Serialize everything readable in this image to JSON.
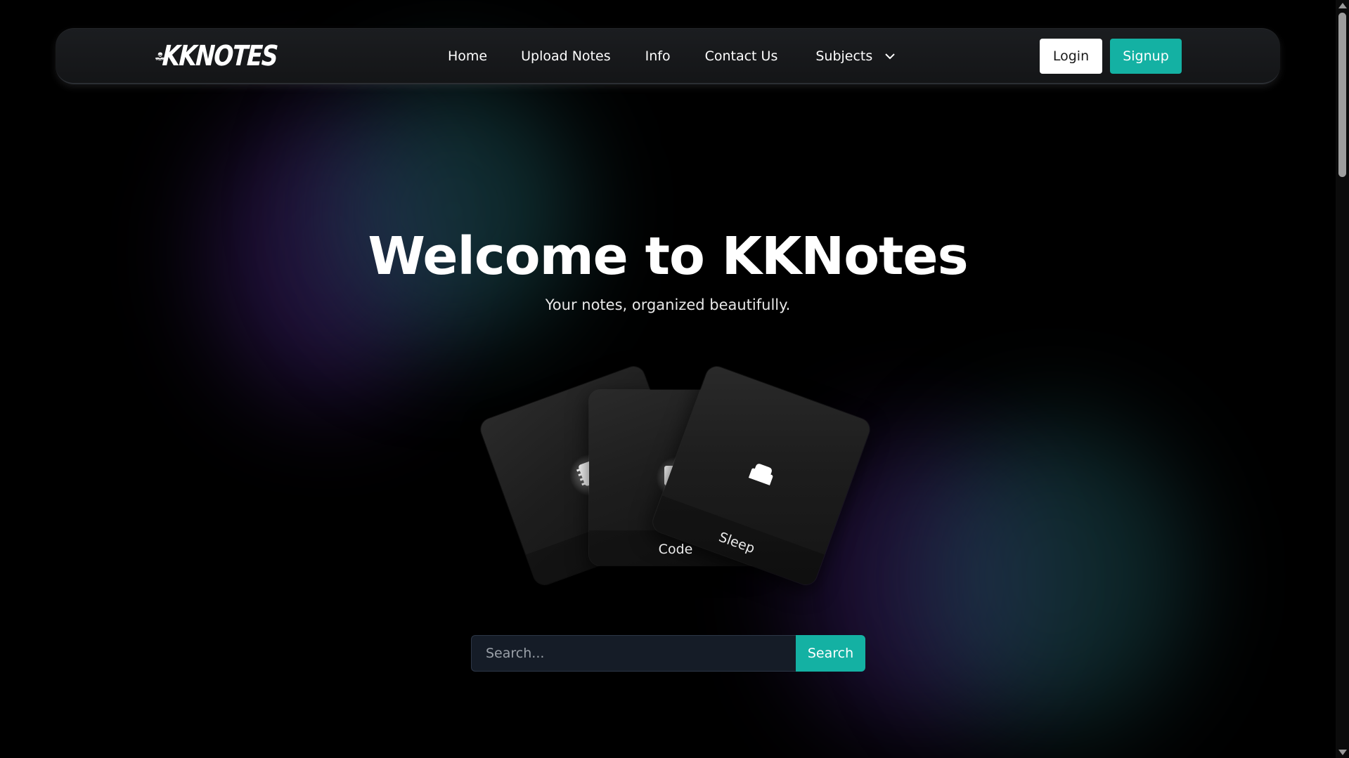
{
  "brand": {
    "logo_text": "KKNOTES"
  },
  "nav": {
    "home": "Home",
    "upload_notes": "Upload Notes",
    "info": "Info",
    "contact_us": "Contact Us",
    "subjects": "Subjects"
  },
  "auth": {
    "login_label": "Login",
    "signup_label": "Signup"
  },
  "hero": {
    "title": "Welcome to KKNotes",
    "subtitle": "Your notes, organized beautifully."
  },
  "cards": [
    {
      "label": "",
      "icon": "notebook-icon"
    },
    {
      "label": "Code",
      "icon": "code-icon"
    },
    {
      "label": "Sleep",
      "icon": "bed-icon"
    }
  ],
  "search": {
    "placeholder": "Search...",
    "value": "",
    "button_label": "Search"
  },
  "colors": {
    "accent": "#14b1a3",
    "background": "#000000",
    "navbar": "#1b1d20"
  }
}
